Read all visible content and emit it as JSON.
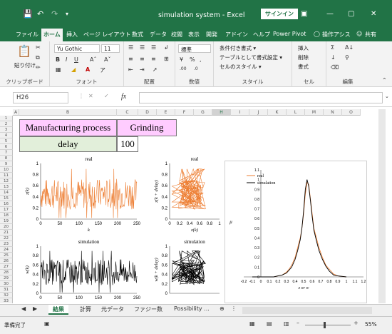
{
  "titlebar": {
    "title": "simulation system  -  Excel",
    "signin": "サインイン",
    "icons": [
      "save-icon",
      "undo-icon",
      "redo-icon",
      "customize-icon",
      "ribbon-display-icon",
      "minimize-icon",
      "restore-icon",
      "close-icon"
    ]
  },
  "tabs": [
    "ファイル",
    "ホーム",
    "挿入",
    "ページ レイアウト",
    "数式",
    "データ",
    "校閲",
    "表示",
    "開発",
    "アドイン",
    "ヘルプ",
    "Power Pivot",
    "操作アシス",
    "共有"
  ],
  "ribbon": {
    "paste": "貼り付け",
    "clipboard": "クリップボード",
    "font_name": "Yu Gothic",
    "font_size": "11",
    "font_group": "フォント",
    "align_group": "配置",
    "number_format": "標準",
    "number_group": "数値",
    "cond_format": "条件付き書式 ▾",
    "table_format": "テーブルとして書式設定 ▾",
    "cell_style": "セルのスタイル ▾",
    "style_group": "スタイル",
    "insert": "挿入",
    "delete": "削除",
    "format": "書式",
    "cells_group": "セル",
    "edit_group": "編集"
  },
  "formula": {
    "name_box": "H26",
    "fx": "fx",
    "content": ""
  },
  "columns": [
    "A",
    "B",
    "C",
    "D",
    "E",
    "F",
    "G",
    "H",
    "I",
    "J",
    "K",
    "L",
    "M",
    "N",
    "O"
  ],
  "rows": [
    "1",
    "2",
    "3",
    "4",
    "5",
    "6",
    "7",
    "8",
    "9",
    "10",
    "11",
    "12",
    "13",
    "14",
    "15",
    "16",
    "17",
    "18",
    "19",
    "20",
    "21",
    "22",
    "23",
    "24",
    "25",
    "26",
    "27",
    "28",
    "29",
    "30",
    "31",
    "32",
    "33"
  ],
  "cells": {
    "process_label": "Manufacturing process",
    "process_value": "Grinding",
    "delay_label": "delay",
    "delay_value": "100"
  },
  "chart_data": [
    {
      "type": "line",
      "title": "real",
      "ylabel": "z(k)",
      "xlabel": "k",
      "xlim": [
        0,
        250
      ],
      "ylim": [
        0,
        1
      ],
      "xticks": [
        "0",
        "50",
        "100",
        "150",
        "200",
        "250"
      ],
      "yticks": [
        "0",
        "0.2",
        "0.4",
        "0.6",
        "0.8",
        "1"
      ],
      "color": "#ed7d31",
      "points": 210
    },
    {
      "type": "scatter",
      "title": "real",
      "ylabel": "z(k + delay)",
      "xlabel": "z(k)",
      "xlim": [
        0,
        1
      ],
      "ylim": [
        0,
        1
      ],
      "xticks": [
        "0",
        "0.2",
        "0.4",
        "0.6",
        "0.8",
        "1"
      ],
      "yticks": [
        "0",
        "0.2",
        "0.4",
        "0.6",
        "0.8",
        "1"
      ],
      "color": "#ed7d31",
      "points": 110
    },
    {
      "type": "line",
      "title": "simulation",
      "ylabel": "w(k)",
      "xlabel": "",
      "xlim": [
        0,
        250
      ],
      "ylim": [
        0,
        1
      ],
      "xticks": [
        "0",
        "50",
        "100",
        "150",
        "200",
        "250"
      ],
      "yticks": [
        "0",
        "0.2",
        "0.4",
        "0.6",
        "0.8",
        "1"
      ],
      "color": "#000000",
      "points": 220
    },
    {
      "type": "scatter",
      "title": "simulation",
      "ylabel": "w(k + delay)",
      "xlabel": "",
      "xlim": [
        0,
        1
      ],
      "ylim": [
        0,
        1
      ],
      "xticks": [],
      "yticks": [
        "0",
        "0.2",
        "0.4",
        "0.6",
        "0.8",
        "1"
      ],
      "color": "#000000",
      "points": 110
    },
    {
      "type": "line",
      "title": "",
      "ylabel": "μ",
      "xlabel": "z or w",
      "xlim": [
        -0.2,
        1.2
      ],
      "ylim": [
        0,
        1.1
      ],
      "xticks": [
        "-0.2",
        "-0.1",
        "0",
        "0.1",
        "0.2",
        "0.3",
        "0.4",
        "0.5",
        "0.6",
        "0.7",
        "0.8",
        "0.9",
        "1",
        "1.1",
        "1.2"
      ],
      "yticks": [
        "0",
        "0.1",
        "0.2",
        "0.3",
        "0.4",
        "0.5",
        "0.6",
        "0.7",
        "0.8",
        "0.9",
        "1",
        "1.1"
      ],
      "legend_position": "top-left",
      "series": [
        {
          "name": "real",
          "color": "#ed7d31",
          "x": [
            -0.1,
            0.15,
            0.2,
            0.25,
            0.3,
            0.33,
            0.36,
            0.4,
            0.43,
            0.46,
            0.48,
            0.5,
            0.52,
            0.54,
            0.56,
            0.58,
            0.6,
            0.62,
            0.65,
            0.68,
            0.72,
            0.76,
            0.8,
            0.85,
            0.9,
            1.0
          ],
          "y": [
            0,
            0,
            0.01,
            0.02,
            0.05,
            0.08,
            0.12,
            0.2,
            0.3,
            0.4,
            0.5,
            0.65,
            0.85,
            0.97,
            0.95,
            0.8,
            0.65,
            0.5,
            0.4,
            0.3,
            0.2,
            0.12,
            0.08,
            0.03,
            0.01,
            0
          ]
        },
        {
          "name": "simulation",
          "color": "#000000",
          "x": [
            -0.1,
            0.15,
            0.2,
            0.25,
            0.3,
            0.33,
            0.36,
            0.4,
            0.43,
            0.46,
            0.48,
            0.5,
            0.52,
            0.54,
            0.56,
            0.58,
            0.6,
            0.62,
            0.65,
            0.68,
            0.72,
            0.76,
            0.8,
            0.85,
            0.9,
            1.0
          ],
          "y": [
            0,
            0,
            0.01,
            0.02,
            0.04,
            0.07,
            0.1,
            0.18,
            0.27,
            0.38,
            0.5,
            0.68,
            0.9,
            1.0,
            0.93,
            0.78,
            0.62,
            0.48,
            0.37,
            0.27,
            0.18,
            0.11,
            0.06,
            0.02,
            0.01,
            0
          ]
        }
      ]
    }
  ],
  "sheets": [
    "結果",
    "計算",
    "元データ",
    "ファジー数",
    "Possibility ..."
  ],
  "status": {
    "ready": "準備完了",
    "zoom": "55%"
  }
}
